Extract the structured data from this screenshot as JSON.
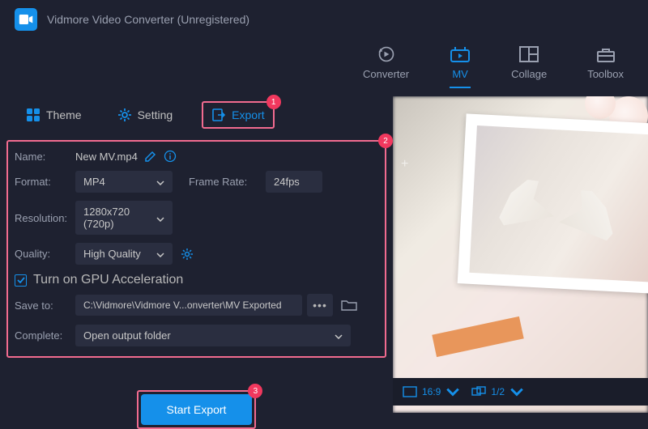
{
  "app_title": "Vidmore Video Converter (Unregistered)",
  "nav": {
    "converter": "Converter",
    "mv": "MV",
    "collage": "Collage",
    "toolbox": "Toolbox"
  },
  "subtabs": {
    "theme": "Theme",
    "setting": "Setting",
    "export": "Export"
  },
  "form": {
    "name_label": "Name:",
    "name_value": "New MV.mp4",
    "format_label": "Format:",
    "format_value": "MP4",
    "framerate_label": "Frame Rate:",
    "framerate_value": "24fps",
    "resolution_label": "Resolution:",
    "resolution_value": "1280x720 (720p)",
    "quality_label": "Quality:",
    "quality_value": "High Quality",
    "gpu_label": "Turn on GPU Acceleration",
    "saveto_label": "Save to:",
    "saveto_value": "C:\\Vidmore\\Vidmore V...onverter\\MV Exported",
    "complete_label": "Complete:",
    "complete_value": "Open output folder"
  },
  "start_export": "Start Export",
  "footer": {
    "aspect": "16:9",
    "fraction": "1/2"
  },
  "badges": {
    "b1": "1",
    "b2": "2",
    "b3": "3"
  },
  "colors": {
    "accent": "#1590ea",
    "highlight": "#f16b8f"
  }
}
